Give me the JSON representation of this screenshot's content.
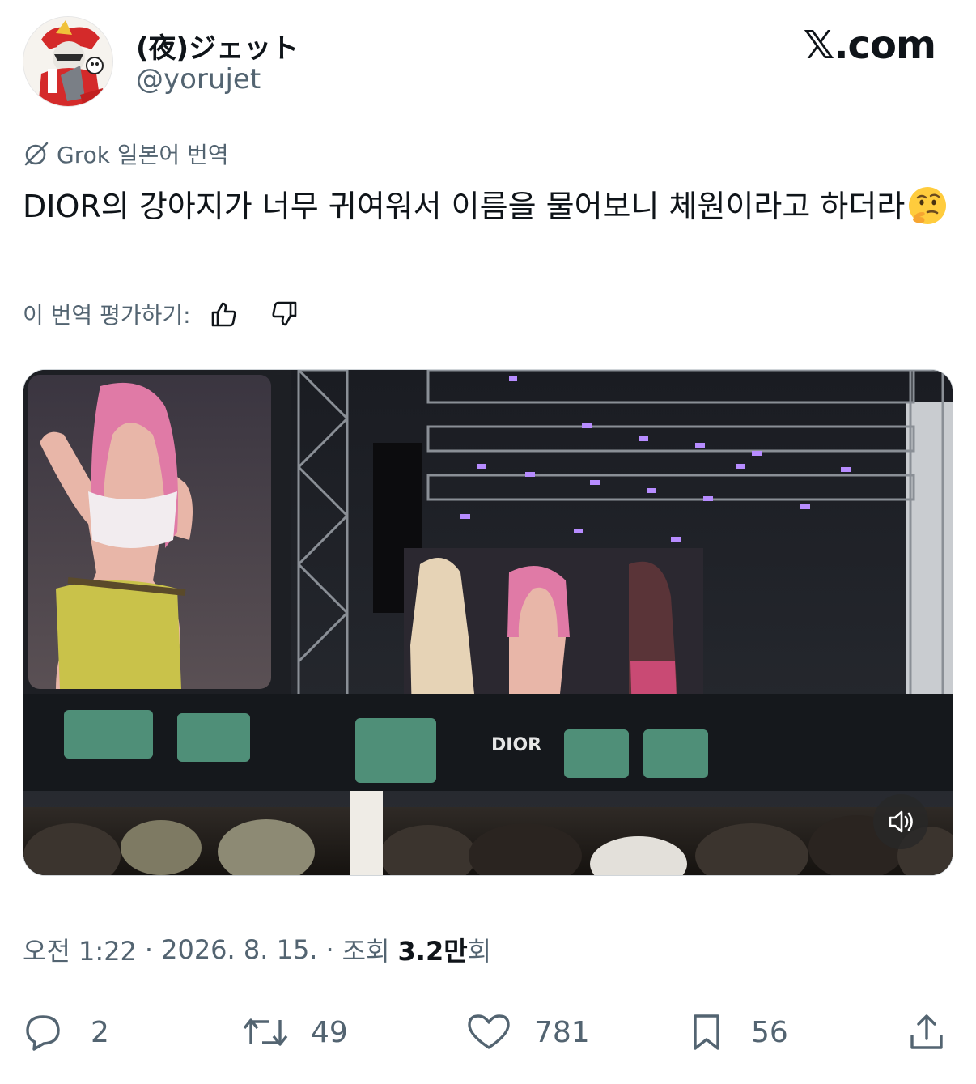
{
  "author": {
    "display_name": "(夜)ジェット",
    "handle": "@yorujet"
  },
  "brand": "𝕏.com",
  "translation": {
    "label": "Grok 일본어 번역"
  },
  "tweet": {
    "text": "DIOR의 강아지가 너무 귀여워서 이름을 물어보니 체원이라고 하더라",
    "emoji": "thinking-face"
  },
  "rate_translation": {
    "label": "이 번역 평가하기:"
  },
  "media": {
    "type": "video",
    "sound": "muted",
    "screen_text": "DIOR"
  },
  "meta": {
    "time": "오전 1:22",
    "date": "2026. 8. 15.",
    "views_prefix": "조회",
    "views_number": "3.2만",
    "views_suffix": "회",
    "separator": "·"
  },
  "actions": {
    "replies": "2",
    "reposts": "49",
    "likes": "781",
    "bookmarks": "56"
  },
  "colors": {
    "text": "#0f1419",
    "secondary": "#536471",
    "background": "#ffffff"
  }
}
